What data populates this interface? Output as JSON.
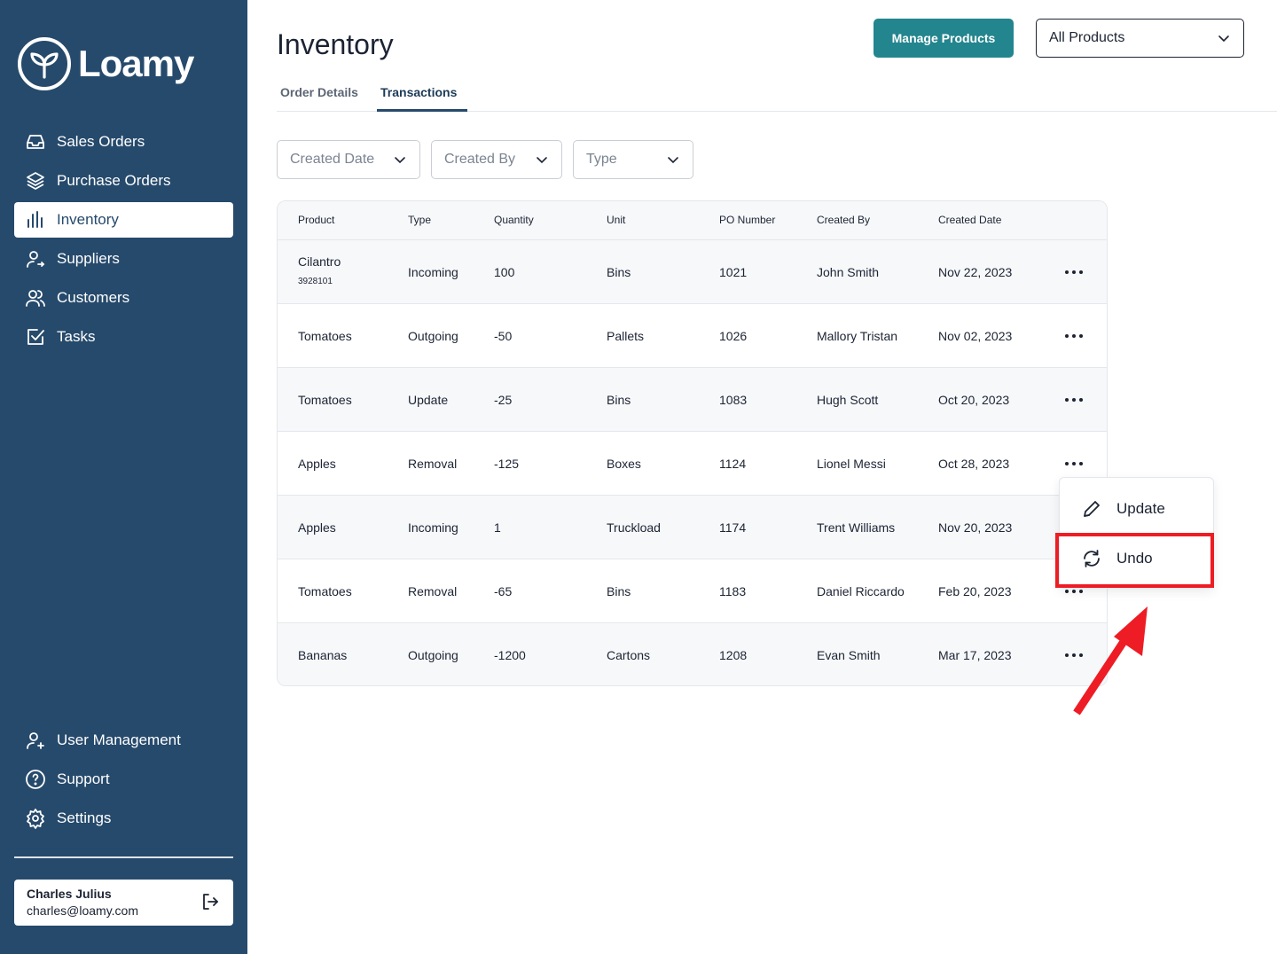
{
  "brand": {
    "name": "Loamy"
  },
  "sidebar": {
    "items": [
      {
        "label": "Sales Orders",
        "icon": "inbox-icon"
      },
      {
        "label": "Purchase Orders",
        "icon": "layers-icon"
      },
      {
        "label": "Inventory",
        "icon": "bar-chart-icon",
        "active": true
      },
      {
        "label": "Suppliers",
        "icon": "user-arrow-icon"
      },
      {
        "label": "Customers",
        "icon": "users-icon"
      },
      {
        "label": "Tasks",
        "icon": "checkbox-icon"
      }
    ],
    "bottom_items": [
      {
        "label": "User Management",
        "icon": "user-plus-icon"
      },
      {
        "label": "Support",
        "icon": "help-circle-icon"
      },
      {
        "label": "Settings",
        "icon": "gear-icon"
      }
    ],
    "user": {
      "name": "Charles Julius",
      "email": "charles@loamy.com"
    }
  },
  "header": {
    "title": "Inventory",
    "manage_button": "Manage Products",
    "product_select": "All Products"
  },
  "tabs": [
    {
      "label": "Order Details"
    },
    {
      "label": "Transactions",
      "active": true
    }
  ],
  "filters": [
    {
      "label": "Created Date"
    },
    {
      "label": "Created By"
    },
    {
      "label": "Type"
    }
  ],
  "table": {
    "columns": [
      "Product",
      "Type",
      "Quantity",
      "Unit",
      "PO Number",
      "Created By",
      "Created Date"
    ],
    "rows": [
      {
        "product": "Cilantro",
        "sku": "3928101",
        "type": "Incoming",
        "quantity": "100",
        "unit": "Bins",
        "po": "1021",
        "created_by": "John Smith",
        "date": "Nov 22, 2023"
      },
      {
        "product": "Tomatoes",
        "sku": "",
        "type": "Outgoing",
        "quantity": "-50",
        "unit": "Pallets",
        "po": "1026",
        "created_by": "Mallory Tristan",
        "date": "Nov 02, 2023"
      },
      {
        "product": "Tomatoes",
        "sku": "",
        "type": "Update",
        "quantity": "-25",
        "unit": "Bins",
        "po": "1083",
        "created_by": "Hugh Scott",
        "date": "Oct 20, 2023"
      },
      {
        "product": "Apples",
        "sku": "",
        "type": "Removal",
        "quantity": "-125",
        "unit": "Boxes",
        "po": "1124",
        "created_by": "Lionel Messi",
        "date": "Oct 28, 2023"
      },
      {
        "product": "Apples",
        "sku": "",
        "type": "Incoming",
        "quantity": "1",
        "unit": "Truckload",
        "po": "1174",
        "created_by": "Trent Williams",
        "date": "Nov 20, 2023"
      },
      {
        "product": "Tomatoes",
        "sku": "",
        "type": "Removal",
        "quantity": "-65",
        "unit": "Bins",
        "po": "1183",
        "created_by": "Daniel Riccardo",
        "date": "Feb 20, 2023"
      },
      {
        "product": "Bananas",
        "sku": "",
        "type": "Outgoing",
        "quantity": "-1200",
        "unit": "Cartons",
        "po": "1208",
        "created_by": "Evan Smith",
        "date": "Mar 17, 2023"
      }
    ]
  },
  "menu": {
    "items": [
      {
        "label": "Update",
        "icon": "pencil-icon"
      },
      {
        "label": "Undo",
        "icon": "refresh-icon",
        "highlighted": true
      }
    ]
  },
  "colors": {
    "sidebar": "#264a6c",
    "accent": "#23858e",
    "highlight": "#ee1c24"
  }
}
